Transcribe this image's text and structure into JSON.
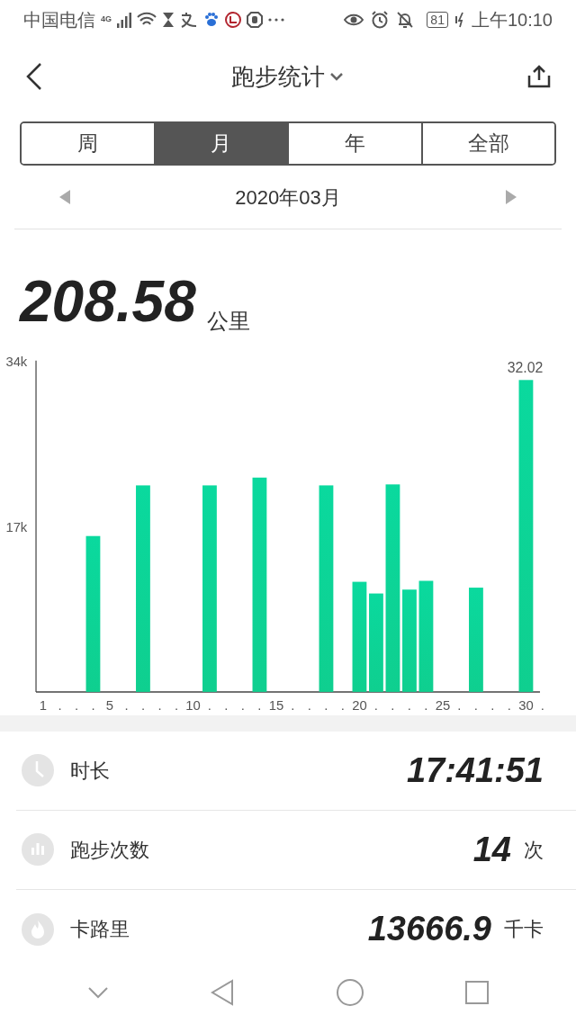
{
  "status_bar": {
    "carrier": "中国电信",
    "network": "4G",
    "battery": "81",
    "time": "上午10:10"
  },
  "header": {
    "title": "跑步统计"
  },
  "tabs": [
    {
      "label": "周",
      "selected": false
    },
    {
      "label": "月",
      "selected": true
    },
    {
      "label": "年",
      "selected": false
    },
    {
      "label": "全部",
      "selected": false
    }
  ],
  "date_nav": {
    "label": "2020年03月"
  },
  "summary": {
    "value": "208.58",
    "unit": "公里"
  },
  "chart_data": {
    "type": "bar",
    "categories": [
      "1",
      ".",
      ".",
      ".",
      "5",
      ".",
      ".",
      ".",
      ".",
      "10",
      ".",
      ".",
      ".",
      ".",
      "15",
      ".",
      ".",
      ".",
      ".",
      "20",
      ".",
      ".",
      ".",
      ".",
      "25",
      ".",
      ".",
      ".",
      ".",
      "30",
      "."
    ],
    "series": [
      {
        "color": "#0fcf8f",
        "values": [
          null,
          null,
          null,
          16.0,
          null,
          null,
          21.2,
          null,
          null,
          null,
          21.2,
          null,
          null,
          22.0,
          null,
          null,
          null,
          21.2,
          null,
          11.3,
          10.1,
          21.3,
          10.5,
          11.4,
          null,
          null,
          10.7,
          null,
          null,
          32.02,
          null
        ]
      }
    ],
    "ylim": [
      0,
      34
    ],
    "yticks": [
      {
        "value": 17,
        "label": "17k"
      },
      {
        "value": 34,
        "label": "34k"
      }
    ],
    "annotations": [
      "32.02"
    ]
  },
  "stats": [
    {
      "kind": "duration",
      "label": "时长",
      "value": "17:41:51"
    },
    {
      "kind": "count",
      "label": "跑步次数",
      "value": "14",
      "unit": "次"
    },
    {
      "kind": "calories",
      "label": "卡路里",
      "value": "13666.9",
      "unit": "千卡"
    }
  ]
}
